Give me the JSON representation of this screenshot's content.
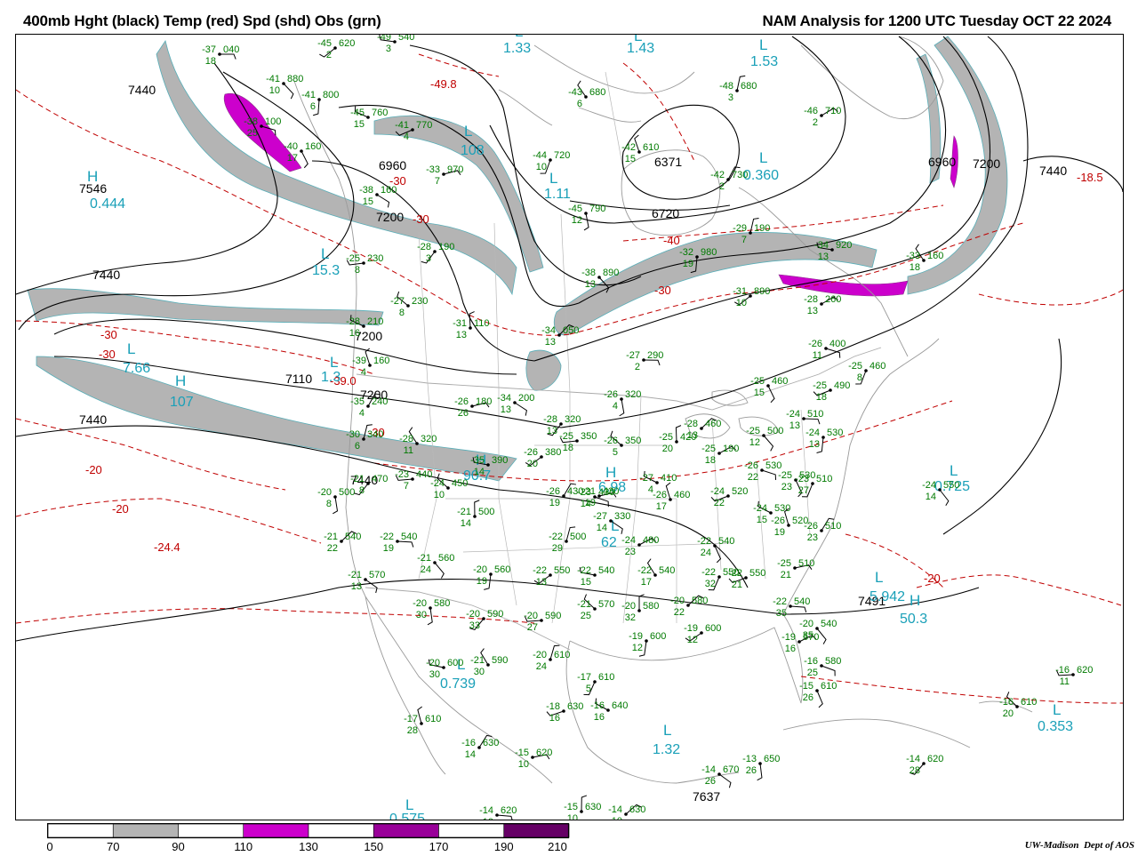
{
  "header": {
    "title_left": "400mb Hght (black) Temp (red) Spd (shd) Obs (grn)",
    "title_right": "NAM Analysis for 1200 UTC Tuesday  OCT 22 2024"
  },
  "colors": {
    "height_contour": "#000000",
    "temp_contour": "#c00000",
    "speed_70_90": "#b4b4b4",
    "speed_110_130": "#cc00cc",
    "speed_150_170": "#990099",
    "speed_190_210": "#660066",
    "obs": "#007a00",
    "center_label": "#1aa0b8",
    "geography": "#999999"
  },
  "height_labels": [
    {
      "text": "7440",
      "name": "height-label"
    },
    {
      "text": "7546",
      "name": "height-label"
    },
    {
      "text": "7440",
      "name": "height-label"
    },
    {
      "text": "7110",
      "name": "height-label"
    },
    {
      "text": "7440",
      "name": "height-label"
    },
    {
      "text": "7200",
      "name": "height-label"
    },
    {
      "text": "6960",
      "name": "height-label"
    },
    {
      "text": "7200",
      "name": "height-label"
    },
    {
      "text": "7200",
      "name": "height-label"
    },
    {
      "text": "6720",
      "name": "height-label"
    },
    {
      "text": "6371",
      "name": "height-label"
    },
    {
      "text": "6960",
      "name": "height-label"
    },
    {
      "text": "7200",
      "name": "height-label"
    },
    {
      "text": "7440",
      "name": "height-label"
    },
    {
      "text": "7440",
      "name": "height-label"
    },
    {
      "text": "7491",
      "name": "height-label"
    },
    {
      "text": "7637",
      "name": "height-label"
    }
  ],
  "temp_labels": [
    {
      "text": "-30"
    },
    {
      "text": "-30"
    },
    {
      "text": "-20"
    },
    {
      "text": "-20"
    },
    {
      "text": "-24.4"
    },
    {
      "text": "-49.8"
    },
    {
      "text": "-30"
    },
    {
      "text": "-30"
    },
    {
      "text": "-40"
    },
    {
      "text": "-30"
    },
    {
      "text": "-18.5"
    },
    {
      "text": "-20"
    },
    {
      "text": "-39.0"
    },
    {
      "text": "-30"
    }
  ],
  "centers": [
    {
      "letter": "H",
      "value": "0.444",
      "kind": "high"
    },
    {
      "letter": "L",
      "value": "15.3",
      "kind": "low"
    },
    {
      "letter": "L",
      "value": "7.66",
      "kind": "low"
    },
    {
      "letter": "H",
      "value": "107",
      "kind": "high"
    },
    {
      "letter": "L",
      "value": "1.33",
      "kind": "low"
    },
    {
      "letter": "L",
      "value": "1.43",
      "kind": "low"
    },
    {
      "letter": "L",
      "value": "1.53",
      "kind": "low"
    },
    {
      "letter": "L",
      "value": "0.360",
      "kind": "low"
    },
    {
      "letter": "L",
      "value": "1.11",
      "kind": "low"
    },
    {
      "letter": "L",
      "value": "108",
      "kind": "low"
    },
    {
      "letter": "L",
      "value": "0.725",
      "kind": "low"
    },
    {
      "letter": "L",
      "value": "5.942",
      "kind": "low"
    },
    {
      "letter": "H",
      "value": "50.3",
      "kind": "high"
    },
    {
      "letter": "L",
      "value": "0.739",
      "kind": "low"
    },
    {
      "letter": "L",
      "value": "1.32",
      "kind": "low"
    },
    {
      "letter": "L",
      "value": "0.353",
      "kind": "low"
    },
    {
      "letter": "L",
      "value": "0.575",
      "kind": "low"
    },
    {
      "letter": "H",
      "value": "6.98",
      "kind": "high"
    },
    {
      "letter": "L",
      "value": "62",
      "kind": "low"
    },
    {
      "letter": "L",
      "value": "1.3",
      "kind": "low"
    },
    {
      "letter": "H",
      "value": "90.7",
      "kind": "high"
    }
  ],
  "stations": [
    {
      "t": "-37",
      "h": "040",
      "d": "18"
    },
    {
      "t": "-41",
      "h": "880",
      "d": "10"
    },
    {
      "t": "-41",
      "h": "800",
      "d": "6"
    },
    {
      "t": "-45",
      "h": "620",
      "d": "2"
    },
    {
      "t": "-49",
      "h": "540",
      "d": "3"
    },
    {
      "t": "-43",
      "h": "680",
      "d": "6"
    },
    {
      "t": "-48",
      "h": "680",
      "d": "3"
    },
    {
      "t": "-46",
      "h": "710",
      "d": "2"
    },
    {
      "t": "-38",
      "h": "100",
      "d": "25"
    },
    {
      "t": "-40",
      "h": "160",
      "d": "17"
    },
    {
      "t": "-44",
      "h": "720",
      "d": "10"
    },
    {
      "t": "-41",
      "h": "770",
      "d": "4"
    },
    {
      "t": "-45",
      "h": "760",
      "d": "15"
    },
    {
      "t": "-42",
      "h": "610",
      "d": "15"
    },
    {
      "t": "-42",
      "h": "730",
      "d": "2"
    },
    {
      "t": "-33",
      "h": "970",
      "d": "7"
    },
    {
      "t": "-38",
      "h": "160",
      "d": "15"
    },
    {
      "t": "-45",
      "h": "790",
      "d": "12"
    },
    {
      "t": "-28",
      "h": "190",
      "d": "3"
    },
    {
      "t": "-25",
      "h": "230",
      "d": "8"
    },
    {
      "t": "-27",
      "h": "230",
      "d": "8"
    },
    {
      "t": "-31",
      "h": "110",
      "d": "13"
    },
    {
      "t": "-34",
      "h": "050",
      "d": "13"
    },
    {
      "t": "-27",
      "h": "290",
      "d": "2"
    },
    {
      "t": "-38",
      "h": "890",
      "d": "13"
    },
    {
      "t": "-32",
      "h": "980",
      "d": "19"
    },
    {
      "t": "-31",
      "h": "890",
      "d": "10"
    },
    {
      "t": "-34",
      "h": "920",
      "d": "13"
    },
    {
      "t": "-33",
      "h": "160",
      "d": "18"
    },
    {
      "t": "-29",
      "h": "190",
      "d": "7"
    },
    {
      "t": "-28",
      "h": "260",
      "d": "13"
    },
    {
      "t": "-26",
      "h": "400",
      "d": "11"
    },
    {
      "t": "-25",
      "h": "460",
      "d": "15"
    },
    {
      "t": "-25",
      "h": "460",
      "d": "8"
    },
    {
      "t": "-25",
      "h": "490",
      "d": "18"
    },
    {
      "t": "-28",
      "h": "210",
      "d": "16"
    },
    {
      "t": "-39",
      "h": "160",
      "d": "4"
    },
    {
      "t": "-35",
      "h": "240",
      "d": "4"
    },
    {
      "t": "-26",
      "h": "180",
      "d": "26"
    },
    {
      "t": "-34",
      "h": "200",
      "d": "13"
    },
    {
      "t": "-26",
      "h": "320",
      "d": "4"
    },
    {
      "t": "-28",
      "h": "320",
      "d": "13"
    },
    {
      "t": "-25",
      "h": "350",
      "d": "18"
    },
    {
      "t": "-26",
      "h": "350",
      "d": "5"
    },
    {
      "t": "-25",
      "h": "420",
      "d": "20"
    },
    {
      "t": "-28",
      "h": "460",
      "d": "13"
    },
    {
      "t": "-24",
      "h": "510",
      "d": "13"
    },
    {
      "t": "-25",
      "h": "500",
      "d": "12"
    },
    {
      "t": "-24",
      "h": "530",
      "d": "13"
    },
    {
      "t": "-26",
      "h": "380",
      "d": "20"
    },
    {
      "t": "-35",
      "h": "390",
      "d": "14"
    },
    {
      "t": "-28",
      "h": "320",
      "d": "11"
    },
    {
      "t": "-30",
      "h": "340",
      "d": "6"
    },
    {
      "t": "-25",
      "h": "190",
      "d": "18"
    },
    {
      "t": "-26",
      "h": "530",
      "d": "22"
    },
    {
      "t": "-25",
      "h": "530",
      "d": "23"
    },
    {
      "t": "-23",
      "h": "510",
      "d": "27"
    },
    {
      "t": "-24",
      "h": "520",
      "d": "22"
    },
    {
      "t": "-27",
      "h": "410",
      "d": "4"
    },
    {
      "t": "-26",
      "h": "460",
      "d": "17"
    },
    {
      "t": "-26",
      "h": "430",
      "d": "19"
    },
    {
      "t": "-21",
      "h": "430",
      "d": "19"
    },
    {
      "t": "-27",
      "h": "330",
      "d": "14"
    },
    {
      "t": "-20",
      "h": "500",
      "d": "8"
    },
    {
      "t": "-21",
      "h": "470",
      "d": "8"
    },
    {
      "t": "-23",
      "h": "440",
      "d": "7"
    },
    {
      "t": "-24",
      "h": "450",
      "d": "10"
    },
    {
      "t": "-21",
      "h": "500",
      "d": "14"
    },
    {
      "t": "-21",
      "h": "540",
      "d": "22"
    },
    {
      "t": "-22",
      "h": "540",
      "d": "19"
    },
    {
      "t": "-21",
      "h": "560",
      "d": "24"
    },
    {
      "t": "-20",
      "h": "560",
      "d": "19"
    },
    {
      "t": "-22",
      "h": "550",
      "d": "13"
    },
    {
      "t": "-22",
      "h": "540",
      "d": "15"
    },
    {
      "t": "-22",
      "h": "540",
      "d": "17"
    },
    {
      "t": "-22",
      "h": "500",
      "d": "29"
    },
    {
      "t": "-24",
      "h": "480",
      "d": "23"
    },
    {
      "t": "-23",
      "h": "430",
      "d": "14"
    },
    {
      "t": "-22",
      "h": "540",
      "d": "24"
    },
    {
      "t": "-22",
      "h": "550",
      "d": "32"
    },
    {
      "t": "-22",
      "h": "550",
      "d": "21"
    },
    {
      "t": "-24",
      "h": "530",
      "d": "15"
    },
    {
      "t": "-26",
      "h": "520",
      "d": "19"
    },
    {
      "t": "-26",
      "h": "510",
      "d": "23"
    },
    {
      "t": "-25",
      "h": "510",
      "d": "21"
    },
    {
      "t": "-21",
      "h": "570",
      "d": "13"
    },
    {
      "t": "-20",
      "h": "580",
      "d": "30"
    },
    {
      "t": "-20",
      "h": "590",
      "d": "33"
    },
    {
      "t": "-20",
      "h": "590",
      "d": "27"
    },
    {
      "t": "-21",
      "h": "570",
      "d": "25"
    },
    {
      "t": "-20",
      "h": "580",
      "d": "32"
    },
    {
      "t": "-20",
      "h": "580",
      "d": "22"
    },
    {
      "t": "-22",
      "h": "540",
      "d": "35"
    },
    {
      "t": "-20",
      "h": "540",
      "d": "35"
    },
    {
      "t": "-19",
      "h": "600",
      "d": "12"
    },
    {
      "t": "-19",
      "h": "600",
      "d": "12"
    },
    {
      "t": "-20",
      "h": "600",
      "d": "30"
    },
    {
      "t": "-21",
      "h": "590",
      "d": "30"
    },
    {
      "t": "-20",
      "h": "610",
      "d": "24"
    },
    {
      "t": "-19",
      "h": "570",
      "d": "16"
    },
    {
      "t": "-16",
      "h": "580",
      "d": "25"
    },
    {
      "t": "-15",
      "h": "610",
      "d": "26"
    },
    {
      "t": "-17",
      "h": "610",
      "d": "5"
    },
    {
      "t": "-18",
      "h": "630",
      "d": "16"
    },
    {
      "t": "-16",
      "h": "640",
      "d": "16"
    },
    {
      "t": "-17",
      "h": "610",
      "d": "28"
    },
    {
      "t": "-16",
      "h": "630",
      "d": "14"
    },
    {
      "t": "-15",
      "h": "620",
      "d": "10"
    },
    {
      "t": "-14",
      "h": "670",
      "d": "26"
    },
    {
      "t": "-13",
      "h": "650",
      "d": "26"
    },
    {
      "t": "-14",
      "h": "620",
      "d": "28"
    },
    {
      "t": "-16",
      "h": "620",
      "d": "11"
    },
    {
      "t": "-16",
      "h": "610",
      "d": "20"
    },
    {
      "t": "-15",
      "h": "630",
      "d": "10"
    },
    {
      "t": "-14",
      "h": "630",
      "d": "10"
    },
    {
      "t": "-14",
      "h": "620",
      "d": "10"
    },
    {
      "t": "-24",
      "h": "550",
      "d": "14"
    }
  ],
  "scale": {
    "ticks": [
      "0",
      "70",
      "90",
      "110",
      "130",
      "150",
      "170",
      "190",
      "210"
    ],
    "bins": [
      {
        "from": "0",
        "to": "70",
        "color": "#ffffff"
      },
      {
        "from": "70",
        "to": "90",
        "color": "#b4b4b4"
      },
      {
        "from": "90",
        "to": "110",
        "color": "#ffffff"
      },
      {
        "from": "110",
        "to": "130",
        "color": "#cc00cc"
      },
      {
        "from": "130",
        "to": "150",
        "color": "#ffffff"
      },
      {
        "from": "150",
        "to": "170",
        "color": "#990099"
      },
      {
        "from": "170",
        "to": "190",
        "color": "#ffffff"
      },
      {
        "from": "190",
        "to": "210",
        "color": "#660066"
      }
    ]
  },
  "credit": {
    "org": "UW-Madison",
    "dept": "Dept of AOS"
  }
}
